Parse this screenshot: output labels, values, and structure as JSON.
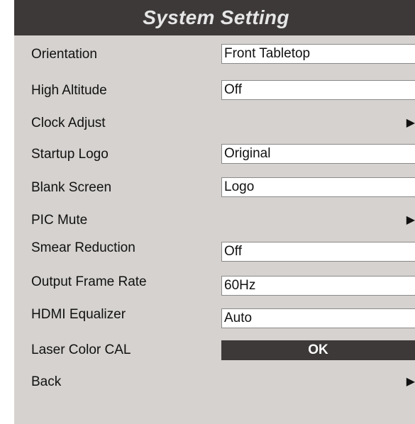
{
  "title": "System Setting",
  "rows": [
    {
      "label": "Orientation",
      "value": "Front Tabletop"
    },
    {
      "label": "High Altitude",
      "value": "Off"
    },
    {
      "label": "Clock Adjust",
      "arrow": "▶"
    },
    {
      "label": "Startup Logo",
      "value": "Original"
    },
    {
      "label": "Blank Screen",
      "value": "Logo"
    },
    {
      "label": "PIC Mute",
      "arrow": "▶"
    },
    {
      "label": "Smear Reduction",
      "value": "Off"
    },
    {
      "label": "Output Frame Rate",
      "value": "60Hz"
    },
    {
      "label": "HDMI Equalizer",
      "value": "Auto"
    },
    {
      "label": "Laser Color CAL",
      "button": "OK"
    },
    {
      "label": "Back",
      "arrow": "▶"
    }
  ],
  "icons": {
    "submenu_arrow": "right-triangle-icon"
  },
  "colors": {
    "title_bar": "#3d3938",
    "panel_background": "#d5d2cf",
    "value_box": "#ffffff",
    "button": "#3d3938"
  }
}
